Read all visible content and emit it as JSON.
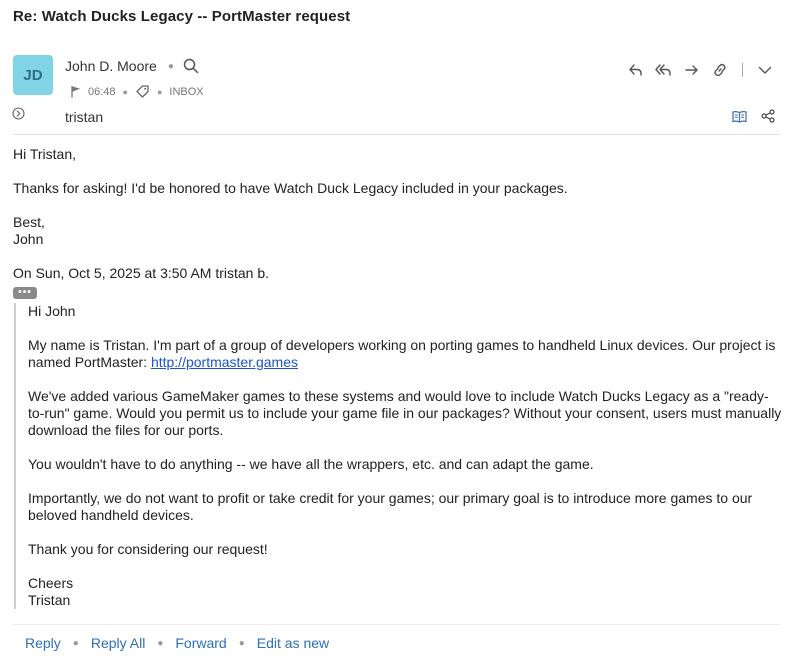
{
  "subject": "Re: Watch Ducks Legacy -- PortMaster request",
  "sender": {
    "initials": "JD",
    "name": "John D. Moore",
    "time": "06:48",
    "folder": "INBOX",
    "avatar_color": "#80d4e6"
  },
  "recipient": "tristan",
  "message": {
    "greeting": "Hi Tristan,",
    "body": "Thanks for asking! I'd be honored to have Watch Duck Legacy included in your packages.",
    "signoff": "Best,",
    "signature": "John",
    "quote_header": "On Sun, Oct 5, 2025 at 3:50 AM tristan b.",
    "ellipsis": "•••"
  },
  "quoted": {
    "greeting": "Hi John",
    "para1": "My name is Tristan. I'm part of a group of developers working on porting games to handheld Linux devices. Our project is named PortMaster: ",
    "link": "http://portmaster.games",
    "para2": "We've added various GameMaker games to these systems and would love to include Watch Ducks Legacy as a \"ready-to-run\" game. Would you permit us to include your game file in our packages? Without your consent, users must manually download the files for our ports.",
    "para3": "You wouldn't have to do anything -- we have all the wrappers, etc. and can adapt the game.",
    "para4": "Importantly, we do not want to profit or take credit for your games; our primary goal is to introduce more games to our beloved handheld devices.",
    "para5": "Thank you for considering our request!",
    "closing": "Cheers",
    "name": "Tristan"
  },
  "footer": {
    "reply": "Reply",
    "reply_all": "Reply All",
    "forward": "Forward",
    "edit_as_new": "Edit as new"
  },
  "icons": {
    "search": "search-icon",
    "flag": "flag-icon",
    "tag": "tag-icon",
    "reply": "reply-icon",
    "reply_all": "reply-all-icon",
    "forward": "forward-icon",
    "link": "link-icon",
    "more": "chevron-down-icon",
    "expand": "expand-recipients-icon",
    "reading": "reading-mode-icon",
    "share": "share-icon"
  }
}
